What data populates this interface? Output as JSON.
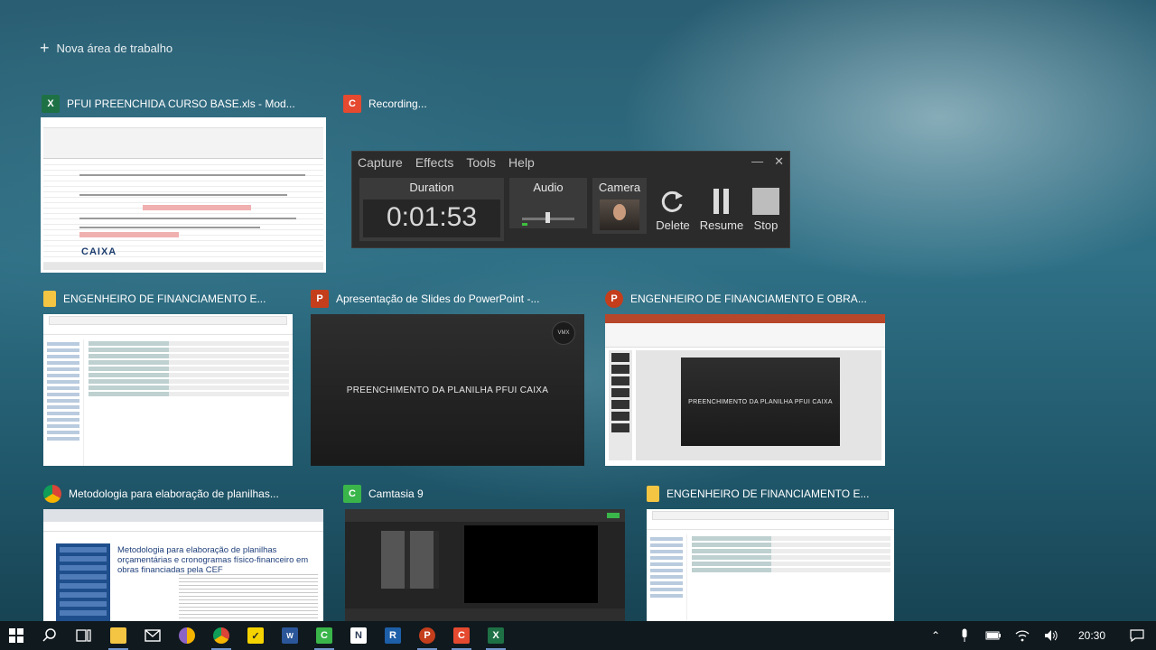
{
  "new_desktop": {
    "label": "Nova área de trabalho"
  },
  "windows": {
    "excel": {
      "title": "PFUI  PREENCHIDA CURSO BASE.xls  -  Mod...",
      "icon": "excel-icon",
      "brand": "CAIXA"
    },
    "recording": {
      "title": "Recording..."
    },
    "explorer1": {
      "title": "ENGENHEIRO DE FINANCIAMENTO E..."
    },
    "slideshow": {
      "title": "Apresentação de Slides do PowerPoint  -...",
      "slide_text": "PREENCHIMENTO DA PLANILHA PFUI CAIXA",
      "logo": "VMX"
    },
    "powerpoint": {
      "title": "ENGENHEIRO DE FINANCIAMENTO E OBRA...",
      "slide_text": "PREENCHIMENTO DA PLANILHA PFUI CAIXA"
    },
    "chrome": {
      "title": "Metodologia para elaboração de planilhas...",
      "page_heading": "Metodologia para elaboração de planilhas orçamentárias e cronogramas físico-financeiro em obras financiadas pela CEF"
    },
    "camtasia": {
      "title": "Camtasia 9"
    },
    "explorer2": {
      "title": "ENGENHEIRO DE FINANCIAMENTO E..."
    }
  },
  "recorder": {
    "menu": [
      "Capture",
      "Effects",
      "Tools",
      "Help"
    ],
    "duration_label": "Duration",
    "duration_value": "0:01:53",
    "audio_label": "Audio",
    "camera_label": "Camera",
    "delete_label": "Delete",
    "resume_label": "Resume",
    "stop_label": "Stop"
  },
  "taskbar": {
    "apps": [
      "file-explorer",
      "mail",
      "chrome-canary",
      "chrome",
      "norton",
      "word-tool",
      "camtasia",
      "notion",
      "revit",
      "powerpoint",
      "camtasia-recorder",
      "excel"
    ],
    "clock": "20:30"
  },
  "colors": {
    "excel": "#1e7145",
    "camtasia": "#3ab54a",
    "recorder": "#e5492f",
    "powerpoint": "#c43e1c",
    "folder": "#f4c542"
  }
}
